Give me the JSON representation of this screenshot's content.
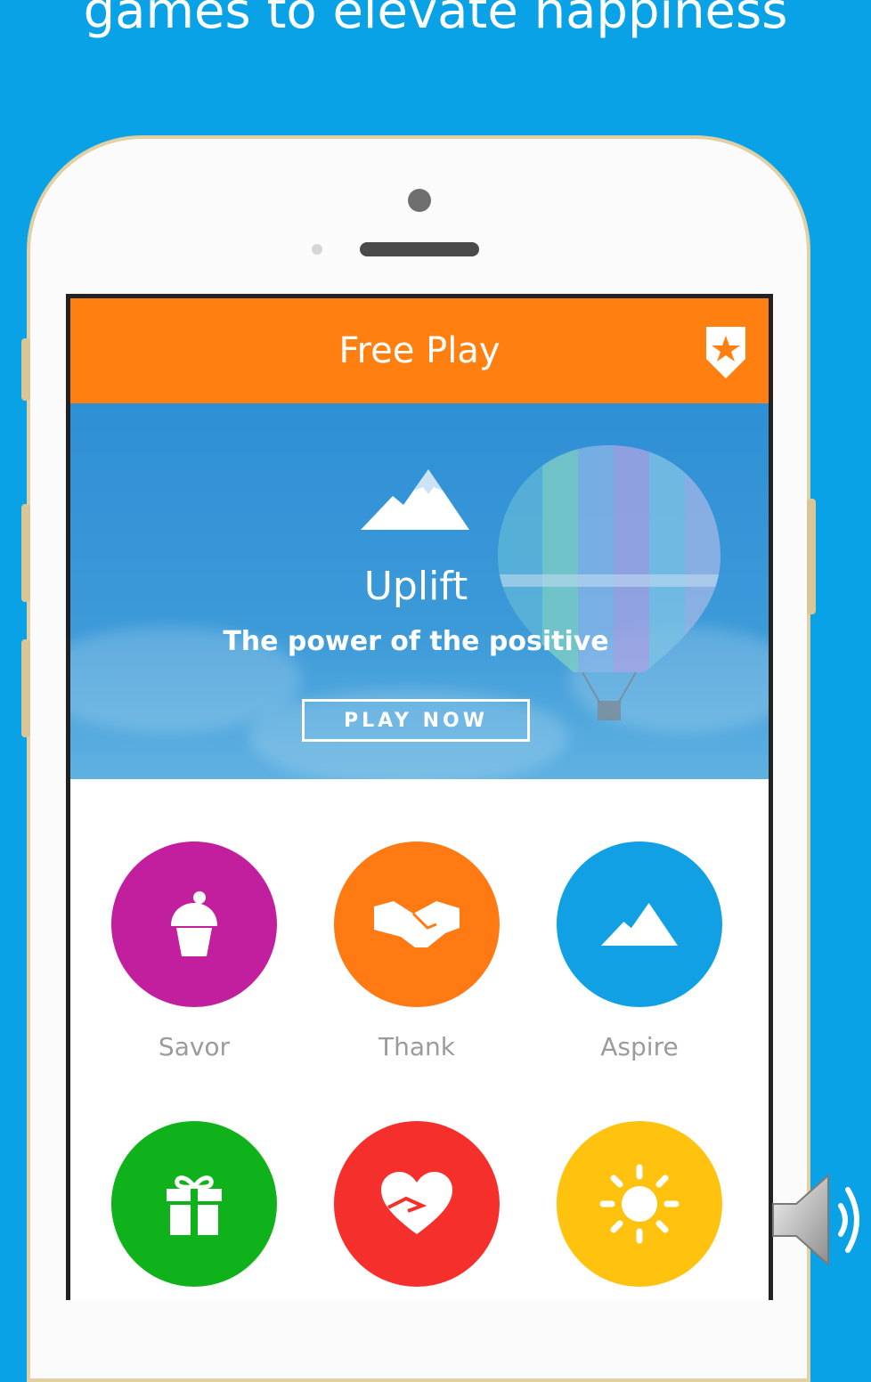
{
  "headline": "games to elevate happiness",
  "app": {
    "header_title": "Free Play",
    "hero": {
      "title": "Uplift",
      "subtitle": "The power of the positive",
      "play_label": "PLAY NOW"
    },
    "games": [
      {
        "label": "Savor",
        "color": "#c21f9e",
        "icon": "cupcake-icon"
      },
      {
        "label": "Thank",
        "color": "#ff7a12",
        "icon": "handshake-icon"
      },
      {
        "label": "Aspire",
        "color": "#12a0e4",
        "icon": "mountain-icon"
      },
      {
        "label": "",
        "color": "#0fb21a",
        "icon": "gift-icon"
      },
      {
        "label": "",
        "color": "#f5302c",
        "icon": "heart-hand-icon"
      },
      {
        "label": "",
        "color": "#ffc20e",
        "icon": "sun-icon"
      }
    ]
  },
  "colors": {
    "background": "#0aa2e6",
    "header": "#ff8010"
  }
}
